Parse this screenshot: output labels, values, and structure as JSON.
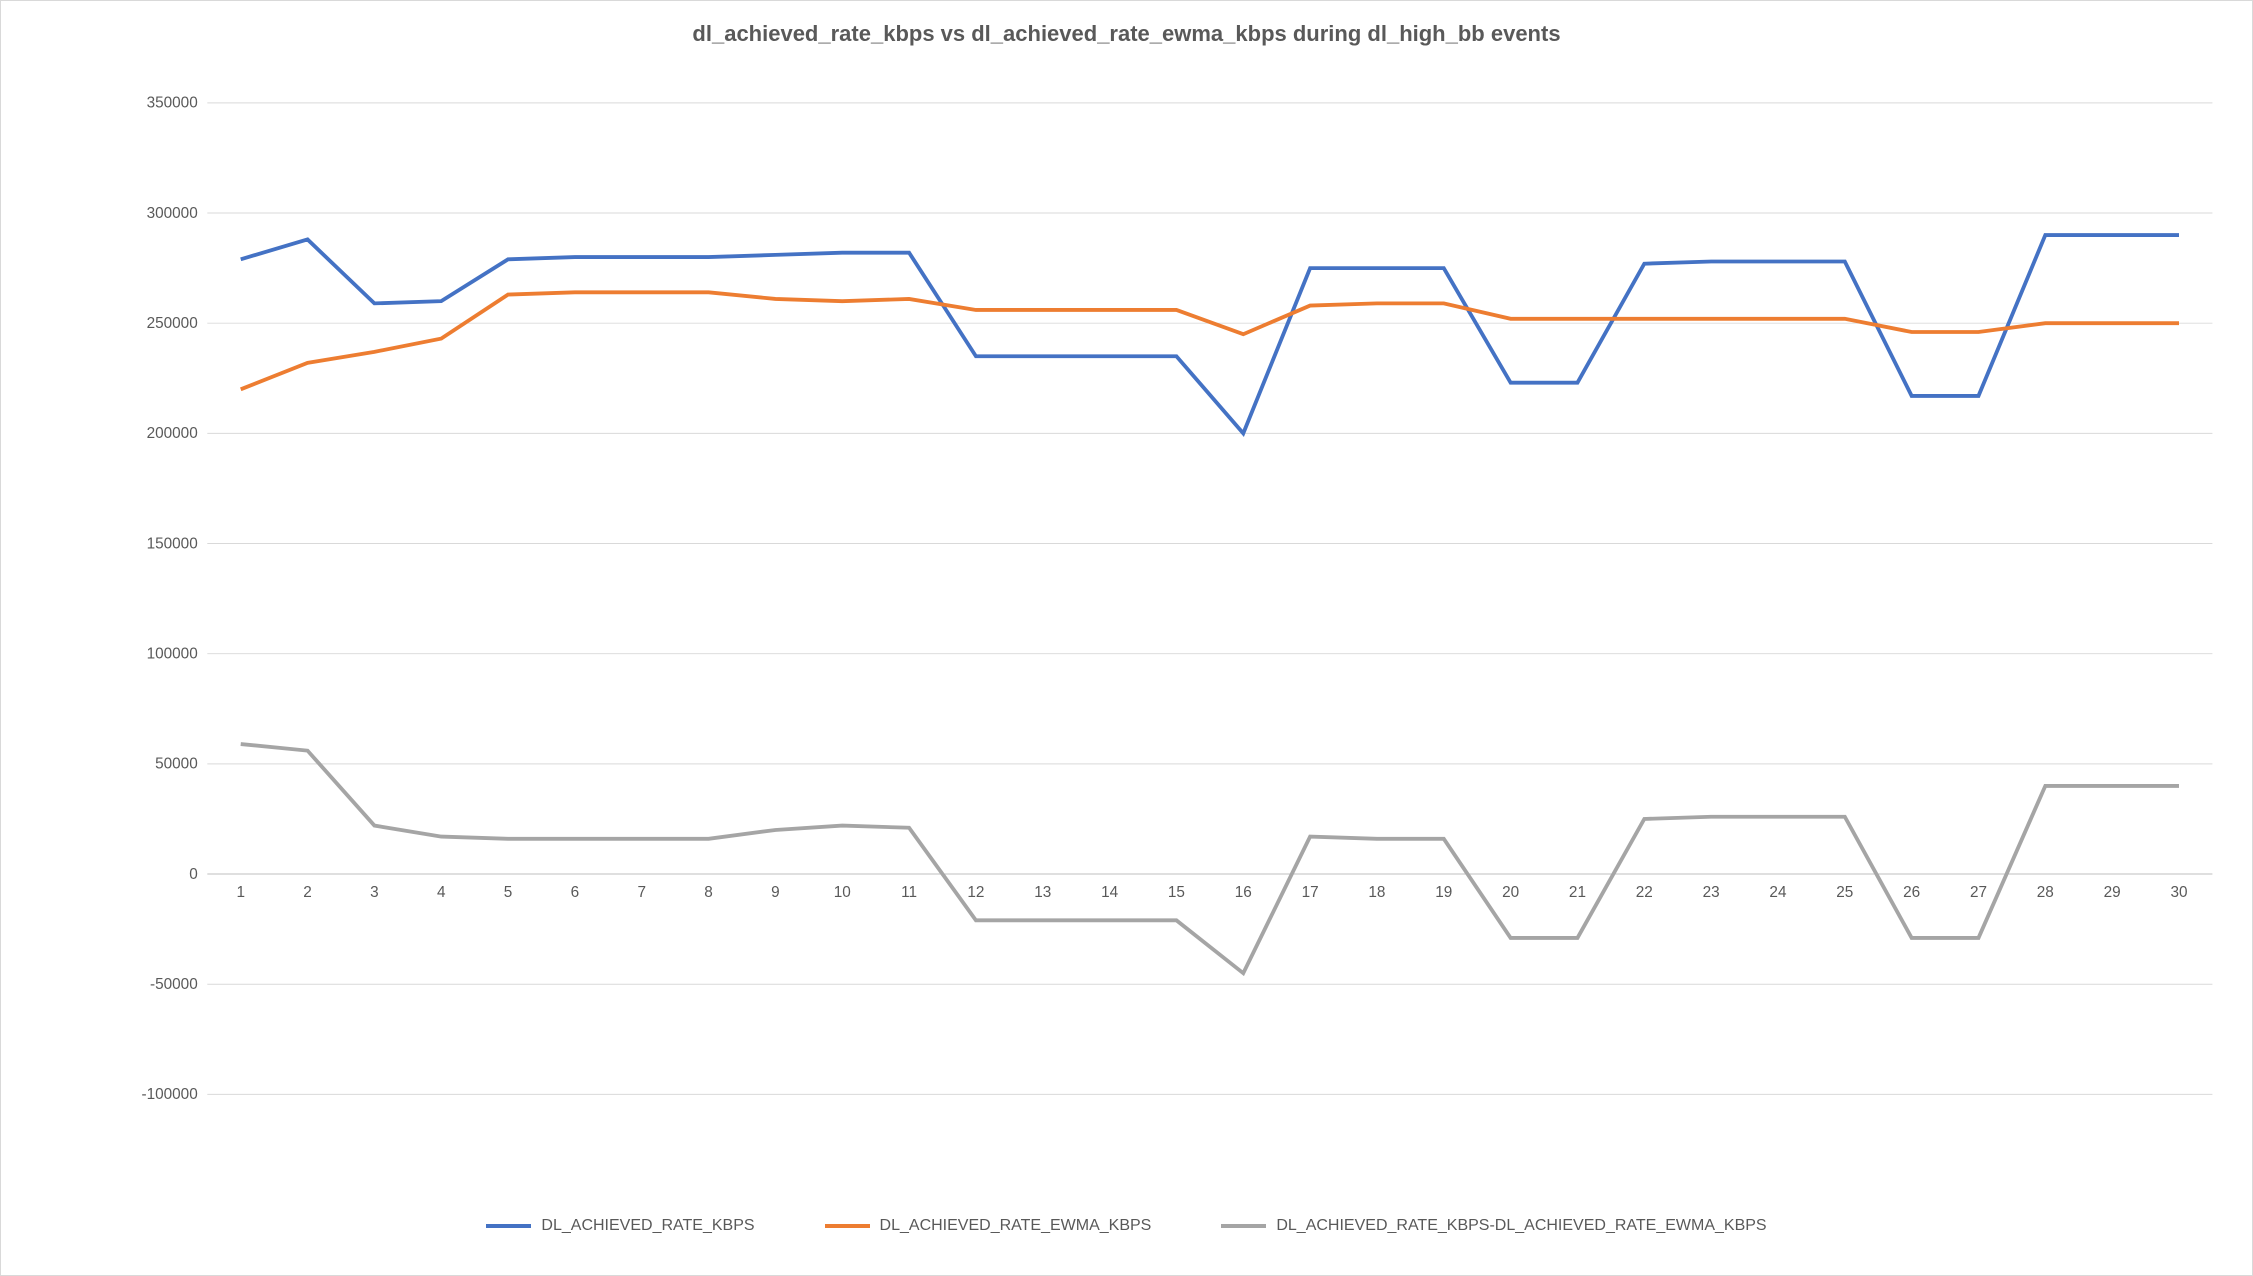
{
  "chart_data": {
    "type": "line",
    "title": "dl_achieved_rate_kbps vs dl_achieved_rate_ewma_kbps during dl_high_bb events",
    "xlabel": "",
    "ylabel": "",
    "categories": [
      1,
      2,
      3,
      4,
      5,
      6,
      7,
      8,
      9,
      10,
      11,
      12,
      13,
      14,
      15,
      16,
      17,
      18,
      19,
      20,
      21,
      22,
      23,
      24,
      25,
      26,
      27,
      28,
      29,
      30
    ],
    "ylim": [
      -100000,
      350000
    ],
    "y_ticks": [
      -100000,
      -50000,
      0,
      50000,
      100000,
      150000,
      200000,
      250000,
      300000,
      350000
    ],
    "series": [
      {
        "name": "DL_ACHIEVED_RATE_KBPS",
        "color": "#4472C4",
        "values": [
          279000,
          288000,
          259000,
          260000,
          279000,
          280000,
          280000,
          280000,
          281000,
          282000,
          282000,
          235000,
          235000,
          235000,
          235000,
          200000,
          275000,
          275000,
          275000,
          223000,
          223000,
          277000,
          278000,
          278000,
          278000,
          217000,
          217000,
          290000,
          290000,
          290000
        ]
      },
      {
        "name": "DL_ACHIEVED_RATE_EWMA_KBPS",
        "color": "#ED7D31",
        "values": [
          220000,
          232000,
          237000,
          243000,
          263000,
          264000,
          264000,
          264000,
          261000,
          260000,
          261000,
          256000,
          256000,
          256000,
          256000,
          245000,
          258000,
          259000,
          259000,
          252000,
          252000,
          252000,
          252000,
          252000,
          252000,
          246000,
          246000,
          250000,
          250000,
          250000
        ]
      },
      {
        "name": "DL_ACHIEVED_RATE_KBPS-DL_ACHIEVED_RATE_EWMA_KBPS",
        "color": "#A5A5A5",
        "values": [
          59000,
          56000,
          22000,
          17000,
          16000,
          16000,
          16000,
          16000,
          20000,
          22000,
          21000,
          -21000,
          -21000,
          -21000,
          -21000,
          -45000,
          17000,
          16000,
          16000,
          -29000,
          -29000,
          25000,
          26000,
          26000,
          26000,
          -29000,
          -29000,
          40000,
          40000,
          40000
        ]
      }
    ]
  }
}
